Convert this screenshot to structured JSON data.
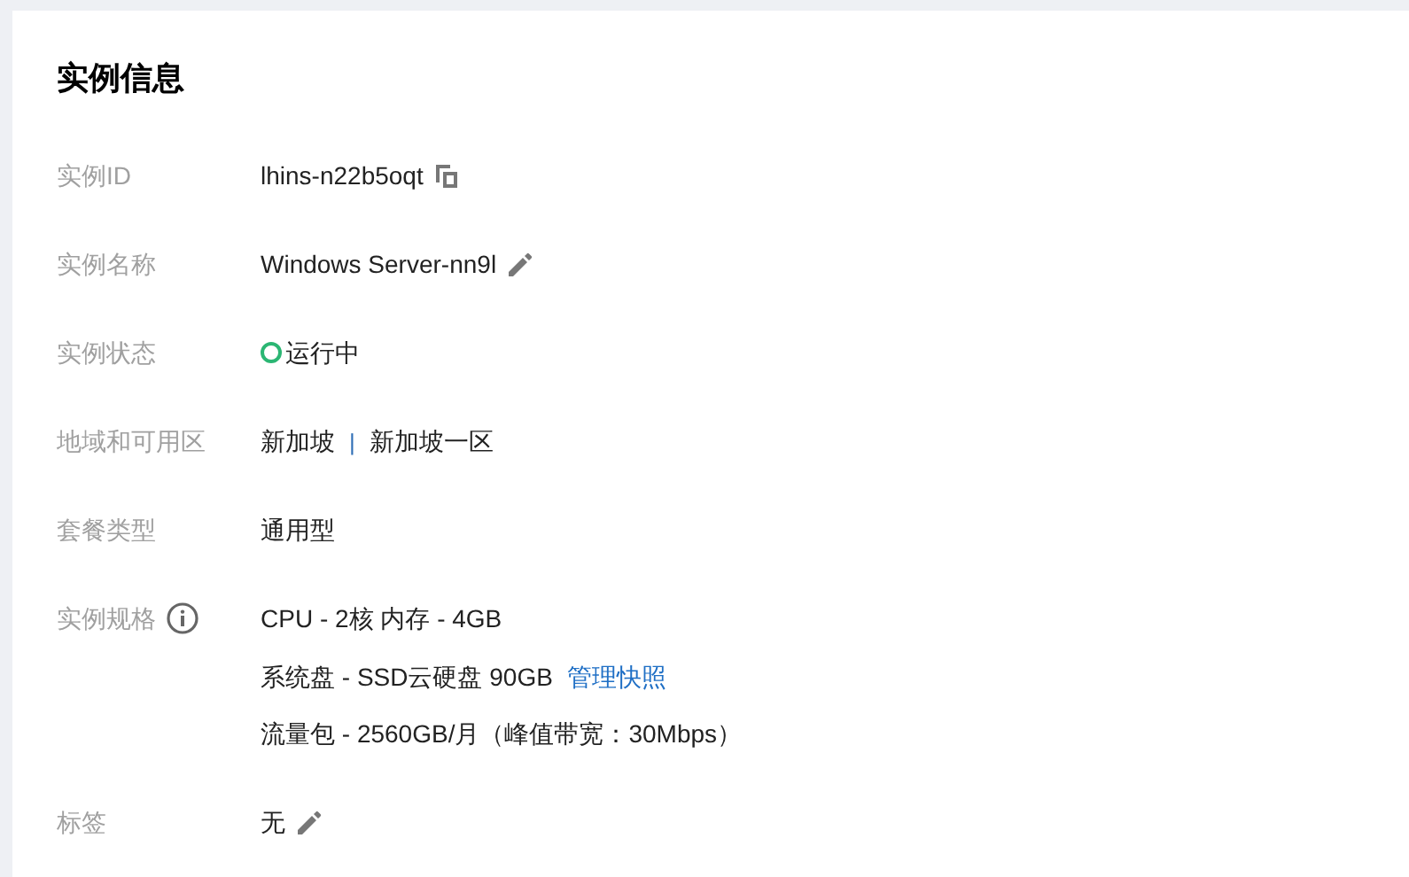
{
  "card": {
    "title": "实例信息",
    "rows": [
      {
        "kind": "copy",
        "label": "实例ID",
        "value": "lhins-n22b5oqt"
      },
      {
        "kind": "edit",
        "label": "实例名称",
        "value": "Windows Server-nn9l"
      },
      {
        "kind": "status",
        "label": "实例状态",
        "value": "运行中",
        "color": "#2bb673"
      },
      {
        "kind": "region",
        "label": "地域和可用区",
        "region": "新加坡",
        "separator": "|",
        "zone": "新加坡一区"
      },
      {
        "kind": "text",
        "label": "套餐类型",
        "value": "通用型"
      },
      {
        "kind": "spec",
        "label": "实例规格",
        "lines": [
          {
            "text": "CPU - 2核 内存 - 4GB"
          },
          {
            "text": "系统盘 - SSD云硬盘 90GB",
            "link": "管理快照"
          },
          {
            "text": "流量包 - 2560GB/月（峰值带宽：30Mbps）"
          }
        ]
      },
      {
        "kind": "edit",
        "label": "标签",
        "value": "无"
      }
    ]
  }
}
